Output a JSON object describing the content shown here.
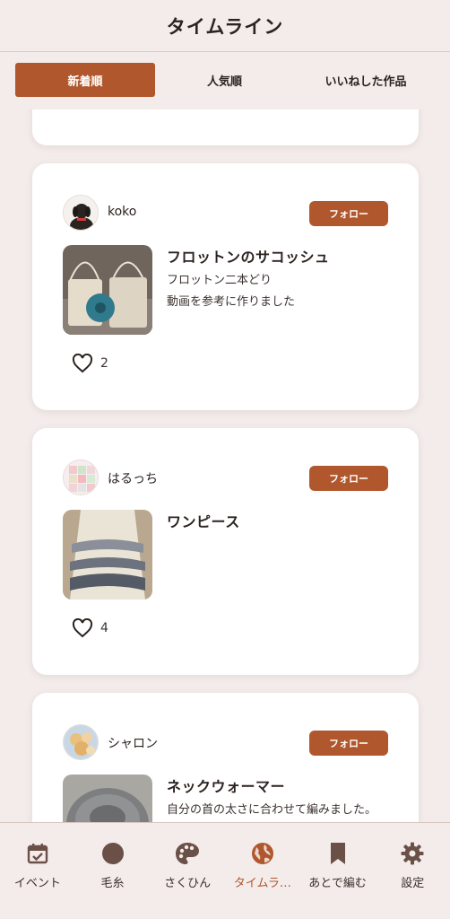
{
  "header": {
    "title": "タイムライン"
  },
  "tabs": [
    {
      "label": "新着順",
      "active": true
    },
    {
      "label": "人気順",
      "active": false
    },
    {
      "label": "いいねした作品",
      "active": false
    }
  ],
  "posts": [
    {
      "username": "koko",
      "follow_label": "フォロー",
      "title": "フロットンのサコッシュ",
      "description_lines": [
        "フロットン二本どり",
        "動画を参考に作りました"
      ],
      "likes": "2"
    },
    {
      "username": "はるっち",
      "follow_label": "フォロー",
      "title": "ワンピース",
      "description_lines": [],
      "likes": "4"
    },
    {
      "username": "シャロン",
      "follow_label": "フォロー",
      "title": "ネックウォーマー",
      "description_lines": [
        "自分の首の太さに合わせて編みました。"
      ],
      "likes": ""
    }
  ],
  "bottom_nav": [
    {
      "label": "イベント",
      "icon": "calendar-check-icon",
      "active": false
    },
    {
      "label": "毛糸",
      "icon": "yarn-ball-icon",
      "active": false
    },
    {
      "label": "さくひん",
      "icon": "palette-icon",
      "active": false
    },
    {
      "label": "タイムラ…",
      "icon": "globe-icon",
      "active": true
    },
    {
      "label": "あとで編む",
      "icon": "bookmark-icon",
      "active": false
    },
    {
      "label": "設定",
      "icon": "gear-icon",
      "active": false
    }
  ],
  "colors": {
    "accent": "#b0572d",
    "background": "#f3ecea",
    "nav_icon": "#6b5048"
  }
}
